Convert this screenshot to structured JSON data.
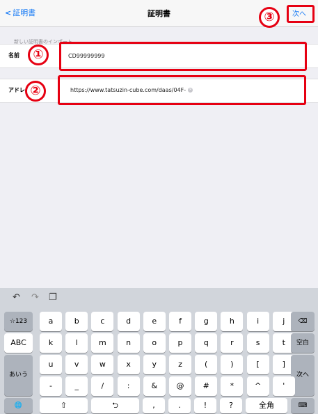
{
  "nav": {
    "back_label": "証明書",
    "title": "証明書",
    "next_label": "次へ"
  },
  "form": {
    "section_header": "新しい証明書のインポート",
    "name_label": "名前",
    "name_value": "CD99999999",
    "address_label": "アドレス",
    "address_value": "https://www.tatsuzin-cube.com/daas/04F-"
  },
  "annotations": {
    "n1": "①",
    "n2": "②",
    "n3": "③"
  },
  "colors": {
    "accent": "#1a7cf5",
    "annotation": "#e60012"
  },
  "keyboard": {
    "toolbar": [
      "undo-icon",
      "redo-icon",
      "paste-icon"
    ],
    "row1_left": "☆123",
    "row1": [
      "a",
      "b",
      "c",
      "d",
      "e",
      "f",
      "g",
      "h",
      "i",
      "j"
    ],
    "row2_left": "ABC",
    "row2": [
      "k",
      "l",
      "m",
      "n",
      "o",
      "p",
      "q",
      "r",
      "s",
      "t"
    ],
    "row2_right": "空白",
    "row3_left": "あいう",
    "row3": [
      "u",
      "v",
      "w",
      "x",
      "y",
      "z",
      "(",
      ")",
      "[",
      "]"
    ],
    "row4": [
      "-",
      "_",
      "/",
      ":",
      "&",
      "@",
      "#",
      "*",
      "^",
      "'"
    ],
    "return_label": "次へ",
    "bottom": [
      "⇧",
      "⮌",
      ",",
      ".",
      "!",
      "?",
      "全角"
    ]
  }
}
